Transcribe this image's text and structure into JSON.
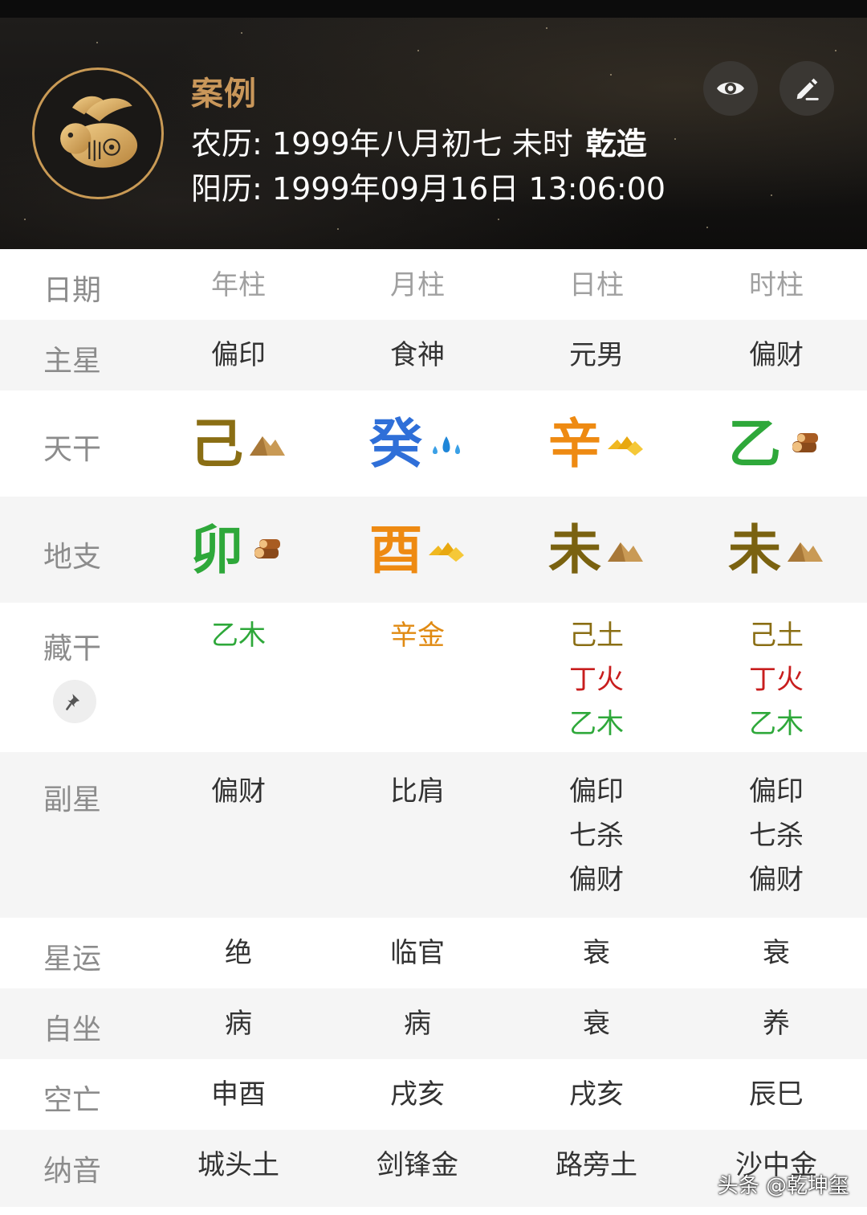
{
  "header": {
    "title": "案例",
    "lunar_label": "农历:",
    "lunar_value": "1999年八月初七 未时",
    "gender": "乾造",
    "solar_label": "阳历:",
    "solar_value": "1999年09月16日 13:06:00",
    "avatar_icon": "rabbit-zodiac-icon",
    "view_icon": "eye-icon",
    "edit_icon": "pencil-icon"
  },
  "columns": {
    "label": "日期",
    "items": [
      "年柱",
      "月柱",
      "日柱",
      "时柱"
    ]
  },
  "main_star": {
    "label": "主星",
    "items": [
      "偏印",
      "食神",
      "元男",
      "偏财"
    ]
  },
  "heavenly_stems": {
    "label": "天干",
    "items": [
      {
        "char": "己",
        "color": "#8a6e14",
        "icon": "earth-mountain-icon"
      },
      {
        "char": "癸",
        "color": "#2f6fd8",
        "icon": "water-drops-icon"
      },
      {
        "char": "辛",
        "color": "#ee8a12",
        "icon": "metal-gold-icon"
      },
      {
        "char": "乙",
        "color": "#2ea83a",
        "icon": "wood-logs-icon"
      }
    ]
  },
  "earthly_branches": {
    "label": "地支",
    "items": [
      {
        "char": "卯",
        "color": "#2ea83a",
        "icon": "wood-logs-icon"
      },
      {
        "char": "酉",
        "color": "#ee8a12",
        "icon": "metal-gold-icon"
      },
      {
        "char": "未",
        "color": "#7a6210",
        "icon": "earth-mountain-icon"
      },
      {
        "char": "未",
        "color": "#7a6210",
        "icon": "earth-mountain-icon"
      }
    ]
  },
  "hidden_stems": {
    "label": "藏干",
    "pin_icon": "pin-icon",
    "items": [
      [
        {
          "text": "乙木",
          "color": "#2ea83a"
        }
      ],
      [
        {
          "text": "辛金",
          "color": "#e08a12"
        }
      ],
      [
        {
          "text": "己土",
          "color": "#8a6e14"
        },
        {
          "text": "丁火",
          "color": "#c81e1e"
        },
        {
          "text": "乙木",
          "color": "#2ea83a"
        }
      ],
      [
        {
          "text": "己土",
          "color": "#8a6e14"
        },
        {
          "text": "丁火",
          "color": "#c81e1e"
        },
        {
          "text": "乙木",
          "color": "#2ea83a"
        }
      ]
    ]
  },
  "sub_star": {
    "label": "副星",
    "items": [
      [
        "偏财"
      ],
      [
        "比肩"
      ],
      [
        "偏印",
        "七杀",
        "偏财"
      ],
      [
        "偏印",
        "七杀",
        "偏财"
      ]
    ]
  },
  "star_fortune": {
    "label": "星运",
    "items": [
      "绝",
      "临官",
      "衰",
      "衰"
    ]
  },
  "self_seat": {
    "label": "自坐",
    "items": [
      "病",
      "病",
      "衰",
      "养"
    ]
  },
  "void": {
    "label": "空亡",
    "items": [
      "申酉",
      "戌亥",
      "戌亥",
      "辰巳"
    ]
  },
  "nayin": {
    "label": "纳音",
    "items": [
      "城头土",
      "剑锋金",
      "路旁土",
      "沙中金"
    ]
  },
  "watermark": "头条 @乾坤玺"
}
